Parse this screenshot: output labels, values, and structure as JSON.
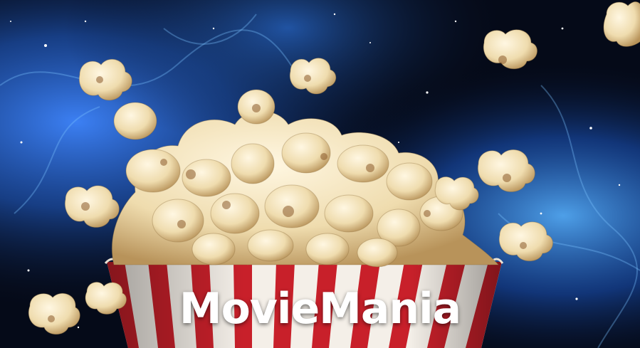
{
  "hero": {
    "brand_name": "MovieMania",
    "image_icon": "popcorn-bucket-in-space-illustration",
    "colors": {
      "brand_text": "#ffffff",
      "space_dark": "#050a18",
      "nebula_blue": "#2b6fd6",
      "stripe_red": "#c8202a",
      "stripe_white": "#f4efe8",
      "popcorn": "#f1dfb4"
    }
  }
}
